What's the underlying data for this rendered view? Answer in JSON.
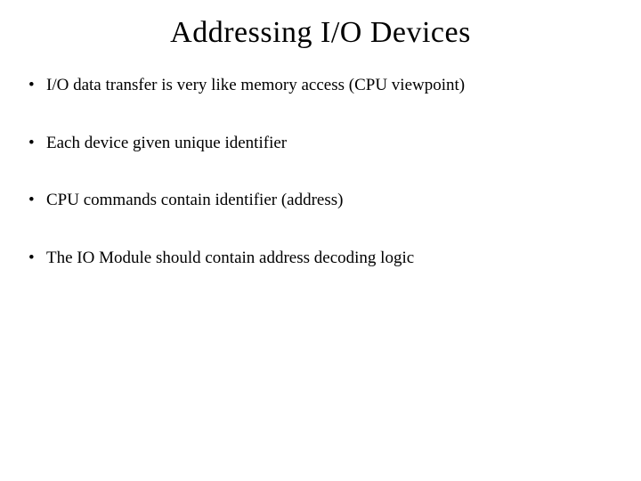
{
  "slide": {
    "title": "Addressing I/O Devices",
    "bullets": [
      "I/O data transfer is very like memory access (CPU viewpoint)",
      "Each device given unique identifier",
      "CPU commands contain identifier (address)",
      "The IO Module should contain address decoding logic"
    ]
  }
}
